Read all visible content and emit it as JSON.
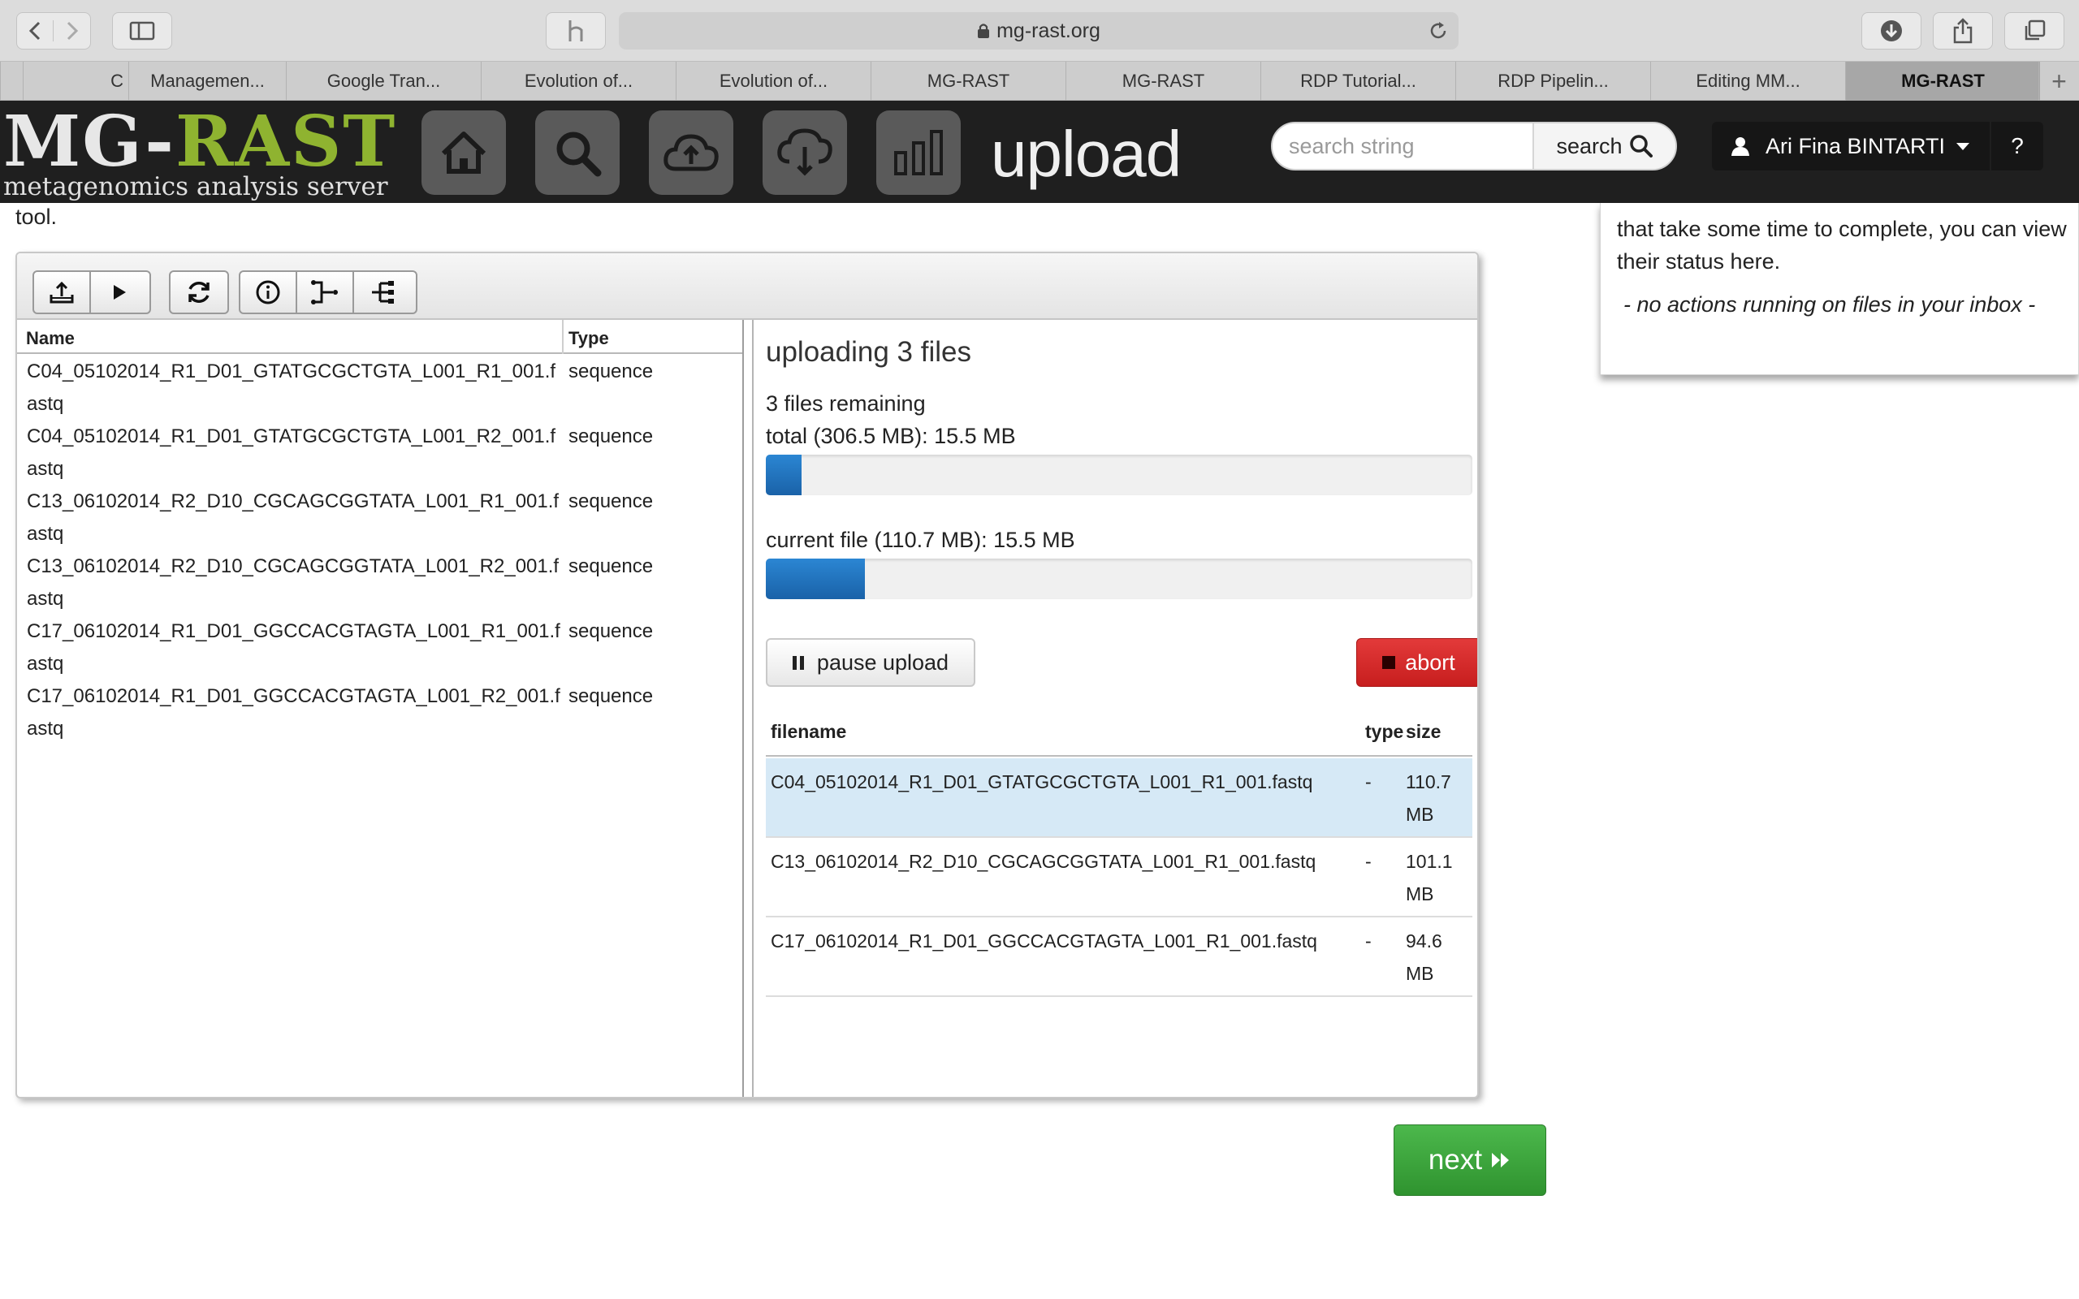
{
  "browser": {
    "url": "mg-rast.org",
    "tabs": [
      {
        "label": "",
        "active": false
      },
      {
        "label": "C",
        "active": false
      },
      {
        "label": "Managemen...",
        "active": false
      },
      {
        "label": "Google Tran...",
        "active": false
      },
      {
        "label": "Evolution of...",
        "active": false
      },
      {
        "label": "Evolution of...",
        "active": false
      },
      {
        "label": "MG-RAST",
        "active": false
      },
      {
        "label": "MG-RAST",
        "active": false
      },
      {
        "label": "RDP Tutorial...",
        "active": false
      },
      {
        "label": "RDP Pipelin...",
        "active": false
      },
      {
        "label": "Editing MM...",
        "active": false
      },
      {
        "label": "MG-RAST",
        "active": true
      }
    ],
    "new_tab": "+"
  },
  "header": {
    "logo_part1": "MG-",
    "logo_part2": "RAST",
    "logo_subtitle": "metagenomics analysis server",
    "page_title": "upload",
    "search_placeholder": "search string",
    "search_label": "search",
    "user_name": "Ari Fina BINTARTI",
    "help_label": "?"
  },
  "intro_tail": "tool.",
  "inbox": {
    "text": "that take some time to complete, you can view their status here.",
    "empty_message": "- no actions running on files in your inbox -"
  },
  "file_browser": {
    "col_name": "Name",
    "col_type": "Type",
    "files": [
      {
        "name": "C04_05102014_R1_D01_GTATGCGCTGTA_L001_R1_001.fastq",
        "type": "sequence"
      },
      {
        "name": "C04_05102014_R1_D01_GTATGCGCTGTA_L001_R2_001.fastq",
        "type": "sequence"
      },
      {
        "name": "C13_06102014_R2_D10_CGCAGCGGTATA_L001_R1_001.fastq",
        "type": "sequence"
      },
      {
        "name": "C13_06102014_R2_D10_CGCAGCGGTATA_L001_R2_001.fastq",
        "type": "sequence"
      },
      {
        "name": "C17_06102014_R1_D01_GGCCACGTAGTA_L001_R1_001.fastq",
        "type": "sequence"
      },
      {
        "name": "C17_06102014_R1_D01_GGCCACGTAGTA_L001_R2_001.fastq",
        "type": "sequence"
      }
    ]
  },
  "upload_status": {
    "title": "uploading 3 files",
    "remaining": "3 files remaining",
    "total_label": "total (306.5 MB): 15.5 MB",
    "total_fraction": 0.05,
    "current_label": "current file (110.7 MB): 15.5 MB",
    "current_fraction": 0.14,
    "pause_label": "pause upload",
    "abort_label": "abort",
    "table_headers": {
      "filename": "filename",
      "type": "type",
      "size": "size"
    },
    "queue": [
      {
        "filename": "C04_05102014_R1_D01_GTATGCGCTGTA_L001_R1_001.fastq",
        "type": "-",
        "size": "110.7 MB",
        "highlight": true
      },
      {
        "filename": "C13_06102014_R2_D10_CGCAGCGGTATA_L001_R1_001.fastq",
        "type": "-",
        "size": "101.1 MB",
        "highlight": false
      },
      {
        "filename": "C17_06102014_R1_D01_GGCCACGTAGTA_L001_R1_001.fastq",
        "type": "-",
        "size": "94.6 MB",
        "highlight": false
      }
    ]
  },
  "next_label": "next",
  "colors": {
    "accent_blue": "#1f6fbd",
    "abort_red": "#d12727",
    "next_green": "#3aa53a",
    "logo_green": "#8fb330",
    "header_bg": "#1f1f1f"
  }
}
